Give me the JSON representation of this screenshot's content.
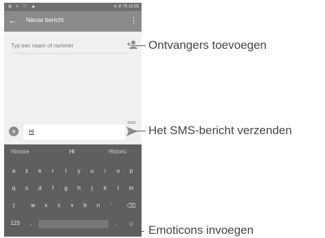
{
  "status_bar": {
    "right_text": "⊘ ⇵ 75 15:55"
  },
  "app_bar": {
    "title": "Nieuw bericht"
  },
  "recipient": {
    "placeholder": "Typ een naam of nummer"
  },
  "compose": {
    "char_counter": "159/1",
    "message_value": "Hi"
  },
  "keyboard": {
    "suggestions": [
      "Histoire",
      "Hi",
      "Historic"
    ],
    "row1": [
      "a",
      "z",
      "e",
      "r",
      "t",
      "y",
      "u",
      "i",
      "o",
      "p"
    ],
    "row2": [
      "q",
      "s",
      "d",
      "f",
      "g",
      "h",
      "j",
      "k",
      "l",
      "m"
    ],
    "row3": [
      "w",
      "x",
      "c",
      "v",
      "b",
      "n",
      "'"
    ],
    "symbols_label": "123",
    "comma": ",",
    "period": "."
  },
  "callouts": {
    "add_recipients": "Ontvangers toevoegen",
    "send_sms": "Het SMS-bericht verzenden",
    "insert_emoticons": "Emoticons invoegen"
  },
  "icons": {
    "back": "back-arrow-icon",
    "menu": "overflow-menu-icon",
    "add_contact": "add-contact-icon",
    "attach": "attach-plus-icon",
    "send": "send-icon",
    "shift": "shift-icon",
    "backspace": "backspace-icon",
    "emoji": "emoji-icon"
  },
  "colors": {
    "app_bar": "#8a8a8a",
    "keyboard": "#5f5f5f",
    "background": "#f0f0f0"
  }
}
